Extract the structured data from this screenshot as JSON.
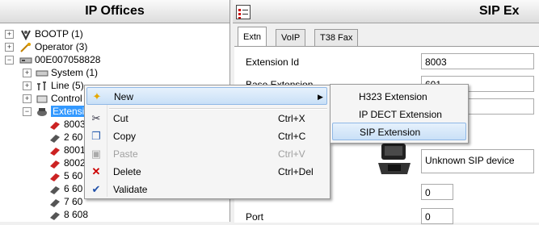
{
  "left_panel": {
    "title": "IP Offices",
    "tree": [
      {
        "label": "BOOTP (1)",
        "icon": "bootp-icon"
      },
      {
        "label": "Operator (3)",
        "icon": "operator-icon"
      },
      {
        "label": "00E007058828",
        "icon": "system-unit-icon"
      },
      {
        "label": "System (1)",
        "icon": "system-icon"
      },
      {
        "label": "Line (5)",
        "icon": "line-icon"
      },
      {
        "label": "Control",
        "icon": "control-unit-icon"
      },
      {
        "label": "Extension",
        "icon": "extension-icon"
      },
      {
        "label": "8003",
        "icon": "phone-icon"
      },
      {
        "label": "2 60",
        "icon": "phone-icon"
      },
      {
        "label": "8001",
        "icon": "phone-icon"
      },
      {
        "label": "8002",
        "icon": "phone-icon"
      },
      {
        "label": "5 60",
        "icon": "phone-icon"
      },
      {
        "label": "6 60",
        "icon": "phone-icon"
      },
      {
        "label": "7 60",
        "icon": "phone-icon"
      },
      {
        "label": "8 608",
        "icon": "phone-icon"
      }
    ]
  },
  "right_panel": {
    "title": "SIP Ex",
    "tabs": [
      "Extn",
      "VoIP",
      "T38 Fax"
    ],
    "fields": {
      "extension_id_label": "Extension Id",
      "extension_id_value": "8003",
      "base_extension_label": "Base Extension",
      "base_extension_value": "601",
      "device_value": "Unknown SIP device",
      "zero_value_1": "0",
      "zero_value_2": "0",
      "port_label": "Port"
    }
  },
  "context_menu": {
    "items": [
      {
        "label": "New",
        "shortcut": "",
        "icon": "new-icon",
        "disabled": false
      },
      {
        "label": "Cut",
        "shortcut": "Ctrl+X",
        "icon": "cut-icon",
        "disabled": false
      },
      {
        "label": "Copy",
        "shortcut": "Ctrl+C",
        "icon": "copy-icon",
        "disabled": false
      },
      {
        "label": "Paste",
        "shortcut": "Ctrl+V",
        "icon": "paste-icon",
        "disabled": true
      },
      {
        "label": "Delete",
        "shortcut": "Ctrl+Del",
        "icon": "delete-icon",
        "disabled": false
      },
      {
        "label": "Validate",
        "shortcut": "",
        "icon": "validate-icon",
        "disabled": false
      }
    ]
  },
  "submenu": {
    "items": [
      "H323 Extension",
      "IP DECT Extension",
      "SIP Extension"
    ]
  },
  "colors": {
    "selection": "#3399ff",
    "menu_highlight": "#c9e0f7",
    "delete_red": "#cc0000"
  }
}
